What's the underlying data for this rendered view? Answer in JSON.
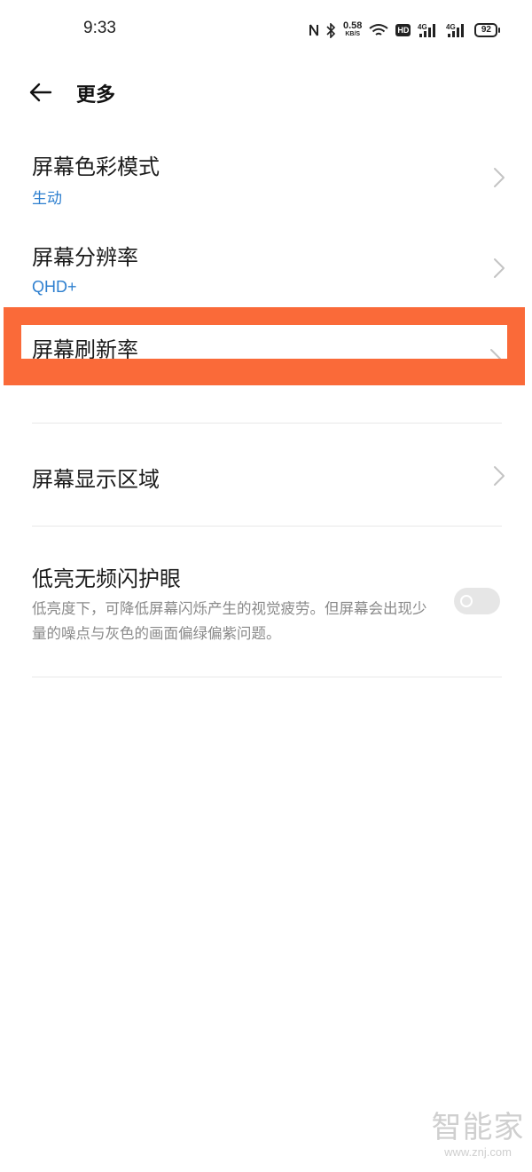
{
  "status_bar": {
    "time": "9:33",
    "net_speed_value": "0.58",
    "net_speed_unit": "KB/S",
    "hd_label": "HD",
    "signal1_label": "4G",
    "signal2_label": "4G",
    "battery_level": "92",
    "icons": [
      "nfc-icon",
      "bluetooth-icon",
      "wifi-icon",
      "hd-icon",
      "signal-icon",
      "signal-icon",
      "battery-icon"
    ]
  },
  "header": {
    "title": "更多",
    "back_icon": "back-arrow-icon"
  },
  "settings": {
    "color_mode": {
      "title": "屏幕色彩模式",
      "value": "生动"
    },
    "resolution": {
      "title": "屏幕分辨率",
      "value": "QHD+"
    },
    "refresh_rate": {
      "title": "屏幕刷新率"
    },
    "display_area": {
      "title": "屏幕显示区域"
    },
    "low_brightness": {
      "title": "低亮无频闪护眼",
      "description": "低亮度下，可降低屏幕闪烁产生的视觉疲劳。但屏幕会出现少量的噪点与灰色的画面偏绿偏紫问题。",
      "enabled": false
    }
  },
  "annotation": {
    "highlight_color": "#fa6a39",
    "highlighted_item": "屏幕刷新率"
  },
  "colors": {
    "accent": "#2d7fcf",
    "secondary_text": "#8a8a8a"
  },
  "watermark": {
    "brand": "智能家",
    "url": "www.znj.com"
  }
}
